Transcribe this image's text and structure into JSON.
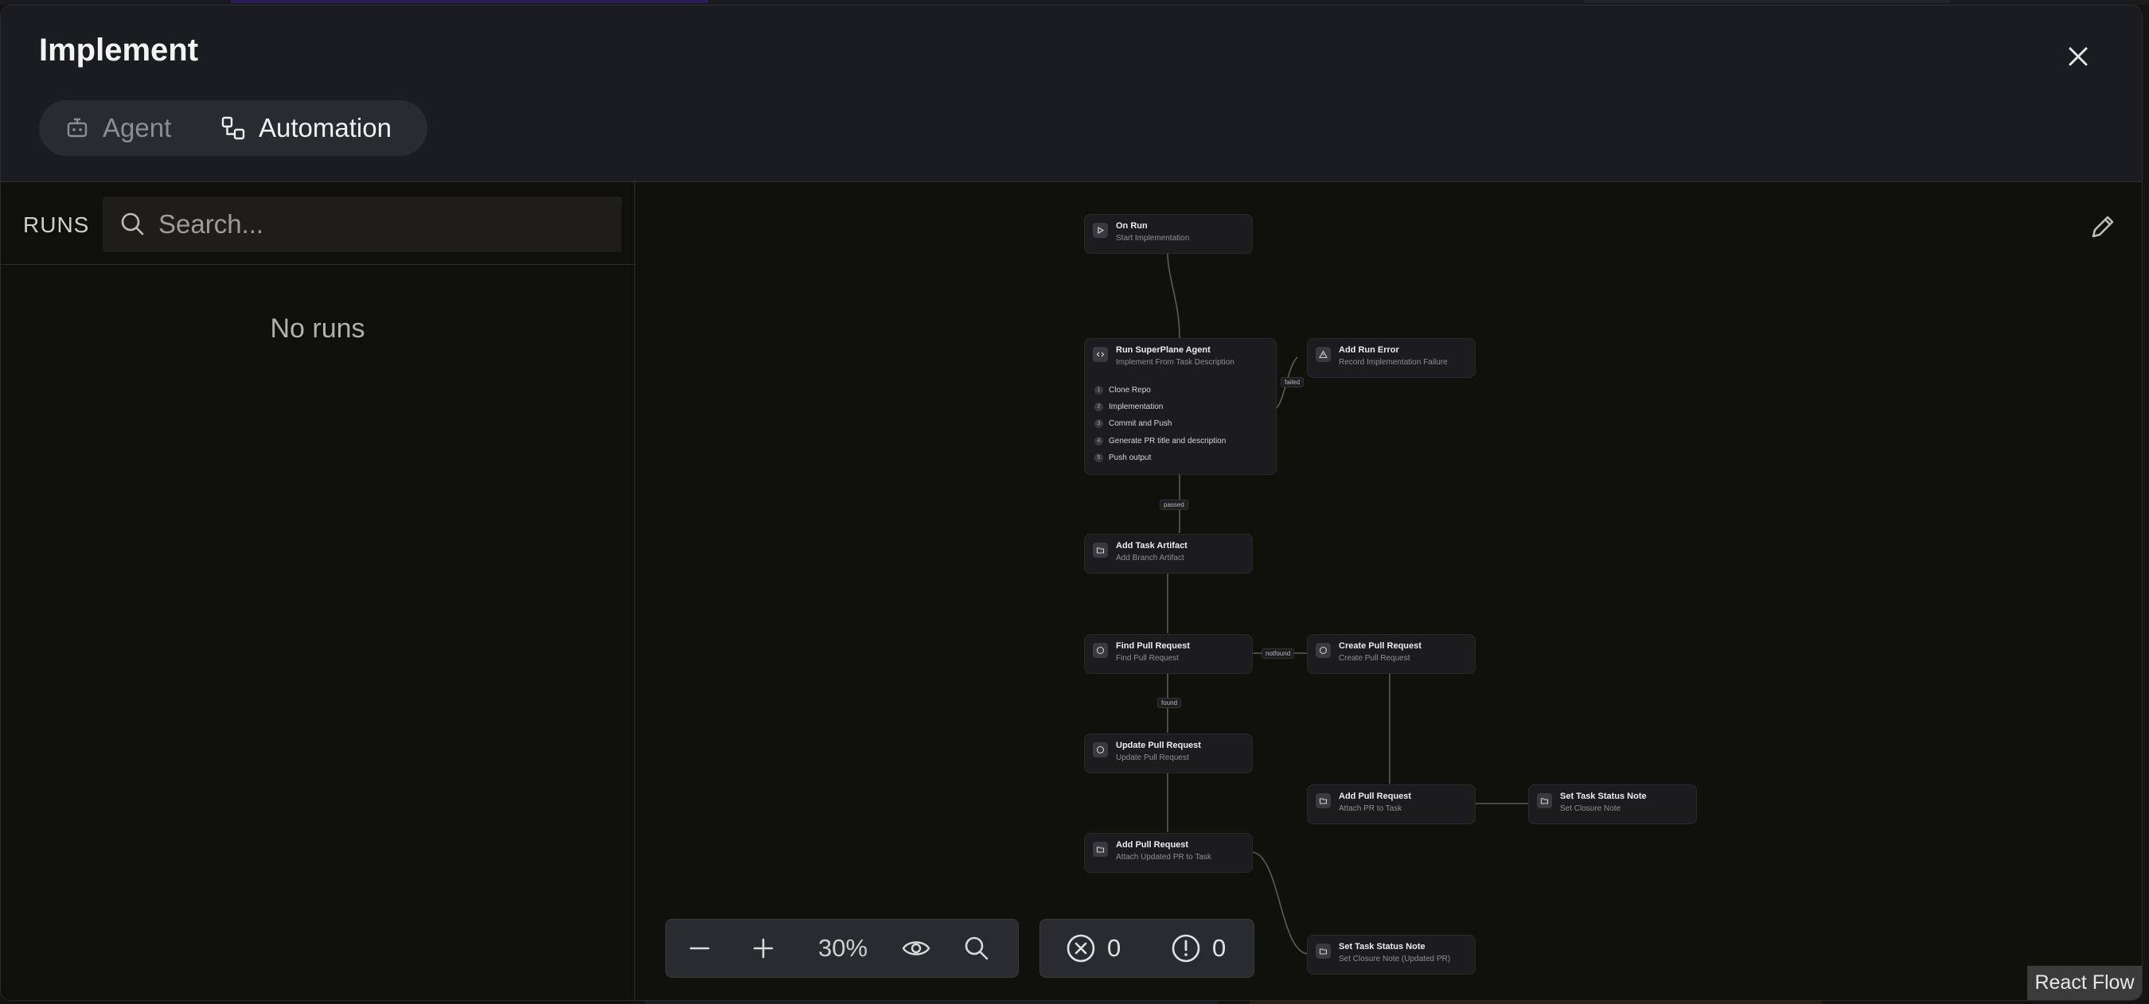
{
  "modal": {
    "title": "Implement",
    "close_icon": "close-icon"
  },
  "tabs": [
    {
      "label": "Agent",
      "icon": "robot-icon",
      "active": false
    },
    {
      "label": "Automation",
      "icon": "workflow-icon",
      "active": true
    }
  ],
  "runs": {
    "label": "RUNS",
    "search_placeholder": "Search...",
    "empty_text": "No runs"
  },
  "canvas": {
    "edit_icon": "pencil-icon",
    "nodes": {
      "on_run": {
        "title": "On Run",
        "subtitle": "Start Implementation",
        "icon": "play-icon"
      },
      "run_agent": {
        "title": "Run SuperPlane Agent",
        "subtitle": "Implement From Task Description",
        "icon": "code-icon",
        "steps": [
          {
            "num": "1",
            "label": "Clone Repo"
          },
          {
            "num": "2",
            "label": "Implementation"
          },
          {
            "num": "3",
            "label": "Commit and Push"
          },
          {
            "num": "4",
            "label": "Generate PR title and description"
          },
          {
            "num": "5",
            "label": "Push output"
          }
        ]
      },
      "add_run_error": {
        "title": "Add Run Error",
        "subtitle": "Record Implementation Failure",
        "icon": "warning-icon"
      },
      "add_task_artifact": {
        "title": "Add Task Artifact",
        "subtitle": "Add Branch Artifact",
        "icon": "folder-icon"
      },
      "find_pr": {
        "title": "Find Pull Request",
        "subtitle": "Find Pull Request",
        "icon": "github-icon"
      },
      "create_pr": {
        "title": "Create Pull Request",
        "subtitle": "Create Pull Request",
        "icon": "github-icon"
      },
      "update_pr": {
        "title": "Update Pull Request",
        "subtitle": "Update Pull Request",
        "icon": "github-icon"
      },
      "add_pr_attach": {
        "title": "Add Pull Request",
        "subtitle": "Attach PR to Task",
        "icon": "folder-icon"
      },
      "set_status_closure": {
        "title": "Set Task Status Note",
        "subtitle": "Set Closure Note",
        "icon": "folder-icon"
      },
      "add_pr_updated": {
        "title": "Add Pull Request",
        "subtitle": "Attach Updated PR to Task",
        "icon": "folder-icon"
      },
      "set_status_updated": {
        "title": "Set Task Status Note",
        "subtitle": "Set Closure Note (Updated PR)",
        "icon": "folder-icon"
      }
    },
    "edge_labels": {
      "failed": "failed",
      "passed": "passed",
      "notfound": "notfound",
      "found": "found"
    }
  },
  "controls": {
    "zoom_out_icon": "minus-icon",
    "zoom_in_icon": "plus-icon",
    "zoom_level": "30%",
    "view_icon": "eye-icon",
    "search_icon": "search-icon"
  },
  "status": {
    "errors_icon": "x-circle-icon",
    "errors_count": "0",
    "warnings_icon": "alert-circle-icon",
    "warnings_count": "0"
  },
  "attribution": "React Flow"
}
